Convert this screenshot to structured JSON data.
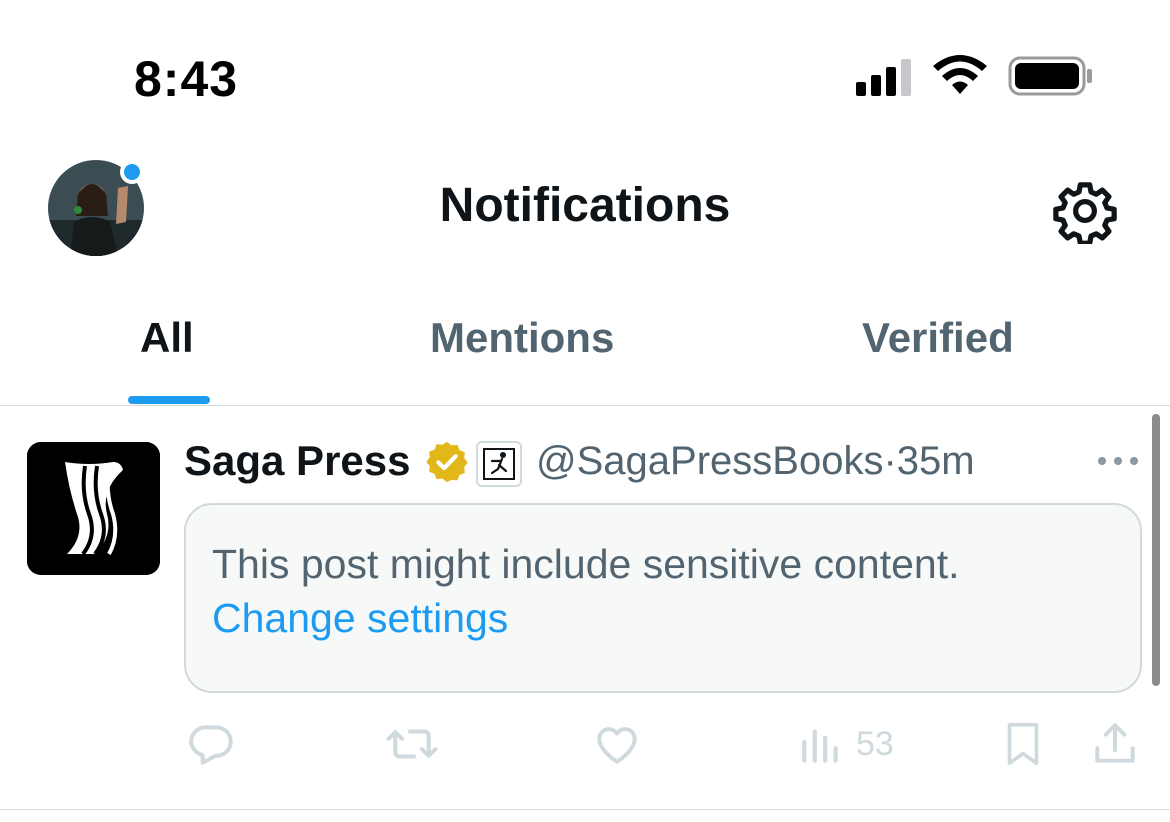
{
  "status_bar": {
    "time": "8:43"
  },
  "header": {
    "title": "Notifications"
  },
  "tabs": [
    {
      "label": "All",
      "active": true
    },
    {
      "label": "Mentions",
      "active": false
    },
    {
      "label": "Verified",
      "active": false
    }
  ],
  "notification": {
    "display_name": "Saga Press",
    "handle": "@SagaPressBooks",
    "separator": "·",
    "time_ago": "35m",
    "sensitive_notice": "This post might include sensitive content.",
    "change_settings_link": "Change settings",
    "views_count": "53"
  },
  "colors": {
    "accent": "#1d9bf0",
    "verified_gold": "#e2b719",
    "secondary_text": "#536471",
    "muted_icon": "#cfd9de"
  },
  "icons": [
    "signal-icon",
    "wifi-icon",
    "battery-icon",
    "gear-icon",
    "verified-badge-icon",
    "emoji-badge-icon",
    "more-icon",
    "reply-icon",
    "repost-icon",
    "like-icon",
    "views-icon",
    "bookmark-icon",
    "share-icon"
  ]
}
